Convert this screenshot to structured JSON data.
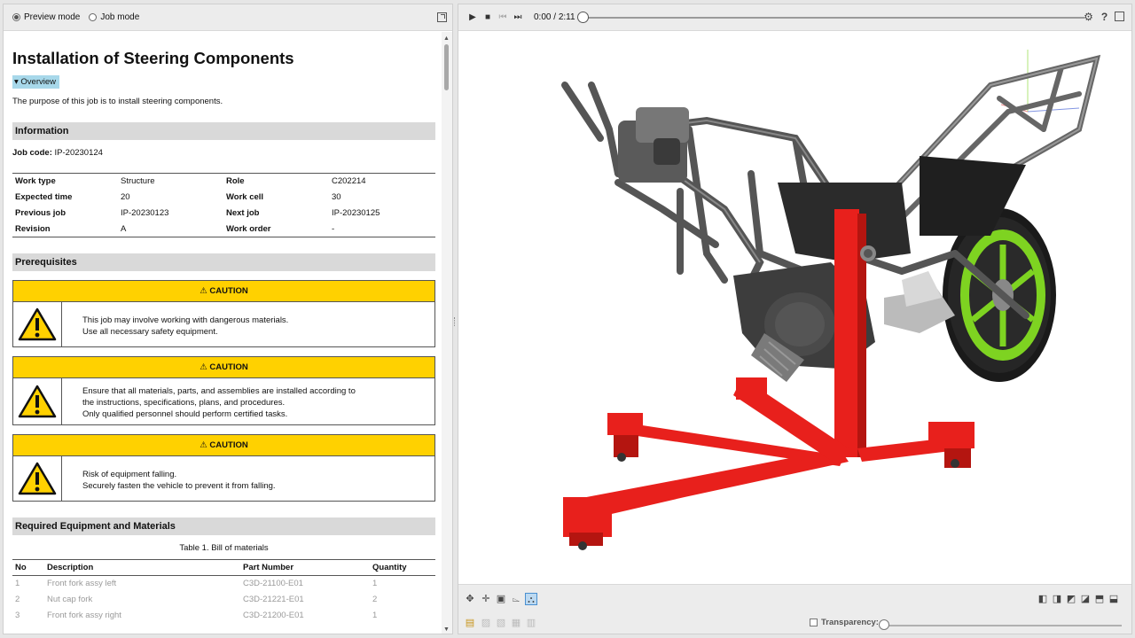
{
  "mode": {
    "preview": "Preview mode",
    "job": "Job mode",
    "selected": "preview"
  },
  "doc": {
    "title": "Installation of Steering Components",
    "overview": "Overview",
    "purpose": "The purpose of this job is to install steering components.",
    "information": {
      "heading": "Information",
      "job_code_label": "Job code:",
      "job_code": "IP-20230124",
      "rows": [
        {
          "k1": "Work type",
          "v1": "Structure",
          "k2": "Role",
          "v2": "C202214"
        },
        {
          "k1": "Expected time",
          "v1": "20",
          "k2": "Work cell",
          "v2": "30"
        },
        {
          "k1": "Previous job",
          "v1": "IP-20230123",
          "k2": "Next job",
          "v2": "IP-20230125"
        },
        {
          "k1": "Revision",
          "v1": "A",
          "k2": "Work order",
          "v2": "-"
        }
      ]
    },
    "prerequisites": {
      "heading": "Prerequisites",
      "cautions": [
        {
          "label": "⚠ CAUTION",
          "lines": [
            "This job may involve working with dangerous materials.",
            "Use all necessary safety equipment."
          ]
        },
        {
          "label": "⚠ CAUTION",
          "lines": [
            "Ensure that all materials, parts, and assemblies are installed according to",
            "the instructions, specifications, plans, and procedures.",
            "Only qualified personnel should perform certified tasks."
          ]
        },
        {
          "label": "⚠ CAUTION",
          "lines": [
            "Risk of equipment falling.",
            "Securely fasten the vehicle to prevent it from falling."
          ]
        }
      ]
    },
    "equipment": {
      "heading": "Required Equipment and Materials",
      "caption": "Table 1. Bill of materials",
      "columns": [
        "No",
        "Description",
        "Part Number",
        "Quantity"
      ],
      "rows": [
        [
          "1",
          "Front fork assy left",
          "C3D-21100-E01",
          "1"
        ],
        [
          "2",
          "Nut cap fork",
          "C3D-21221-E01",
          "2"
        ],
        [
          "3",
          "Front fork assy right",
          "C3D-21200-E01",
          "1"
        ]
      ]
    }
  },
  "player": {
    "current": "0:00",
    "separator": "/",
    "total": "2:11",
    "progress": 0
  },
  "viewer": {
    "transparency_label": "Transparency:",
    "transparency_checked": false,
    "transparency": 0
  },
  "colors": {
    "caution": "#ffd100",
    "overview": "#a7d8ea",
    "stand": "#e8201c",
    "wheel": "#7ed321"
  }
}
